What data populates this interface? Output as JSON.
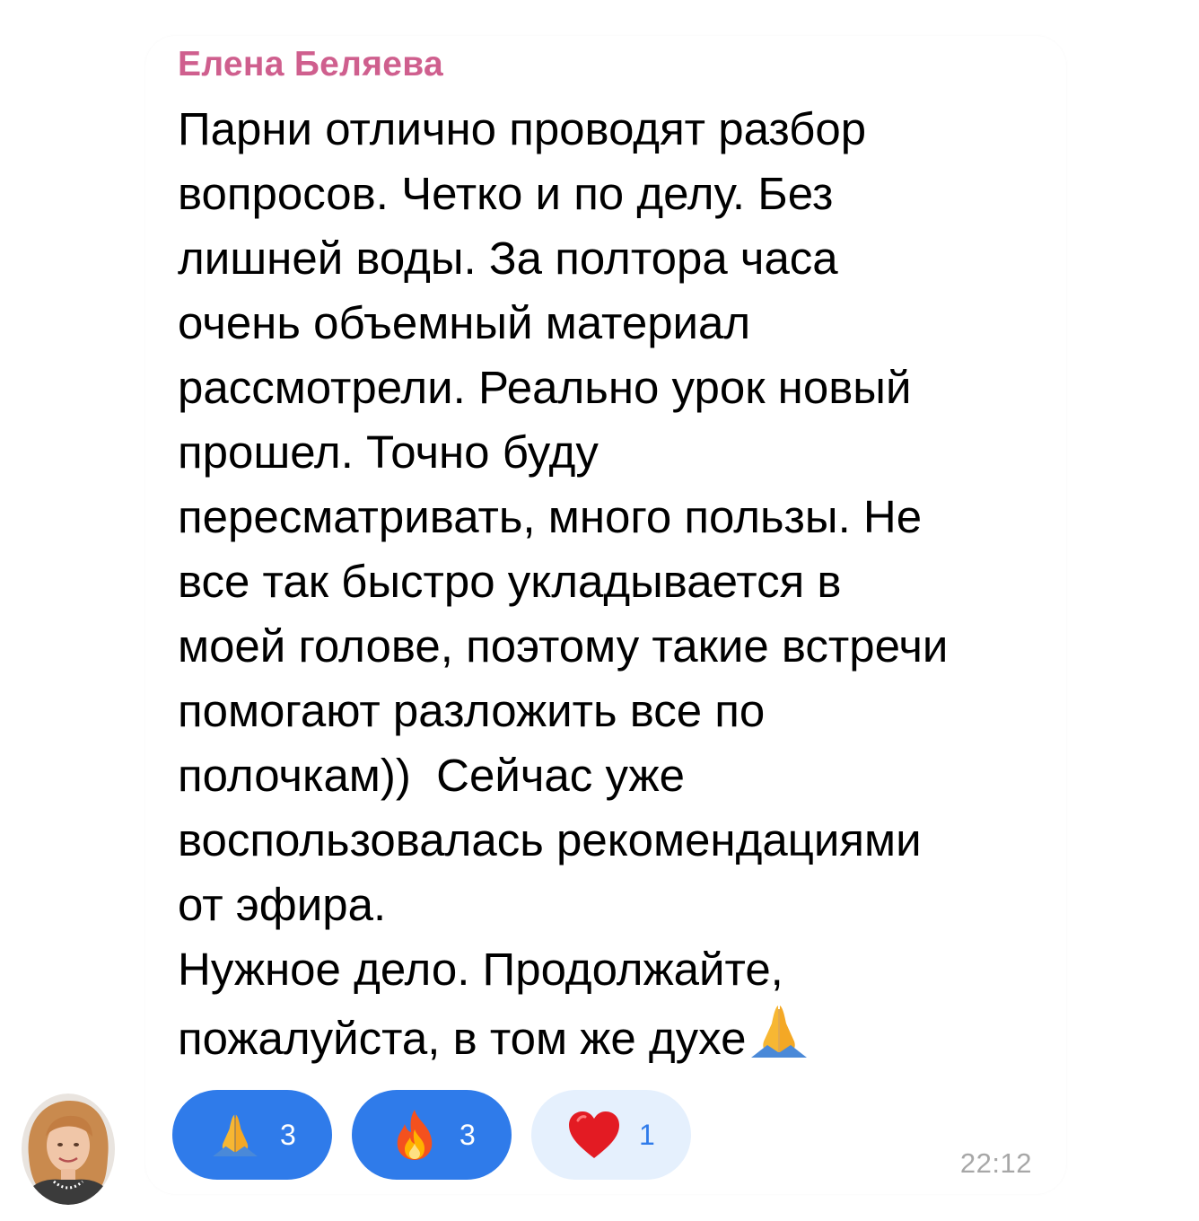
{
  "sender": {
    "name": "Елена Беляева",
    "name_color": "#cf5f8e"
  },
  "message": {
    "lines": [
      "Парни отлично проводят разбор",
      "вопросов. Четко и по делу. Без",
      "лишней воды. За полтора часа",
      "очень объемный материал",
      "рассмотрели. Реально урок новый",
      "прошел. Точно буду",
      "пересматривать, много пользы. Не",
      "все так быстро укладывается в",
      "моей голове, поэтому такие встречи",
      "помогают разложить все по",
      "полочкам))  Сейчас уже",
      "воспользовалась рекомендациями",
      "от эфира.",
      "Нужное дело. Продолжайте,",
      "пожалуйста, в том же духе"
    ],
    "trailing_emoji": "folded-hands-emoji"
  },
  "reactions": [
    {
      "emoji": "folded-hands-emoji",
      "count": "3",
      "active": true
    },
    {
      "emoji": "fire-emoji",
      "count": "3",
      "active": true
    },
    {
      "emoji": "red-heart-emoji",
      "count": "1",
      "active": false
    }
  ],
  "timestamp": "22:12",
  "colors": {
    "accent_blue": "#2f7bea",
    "inactive_reaction_bg": "#e5f0fd",
    "timestamp_gray": "#a7a7a7"
  }
}
